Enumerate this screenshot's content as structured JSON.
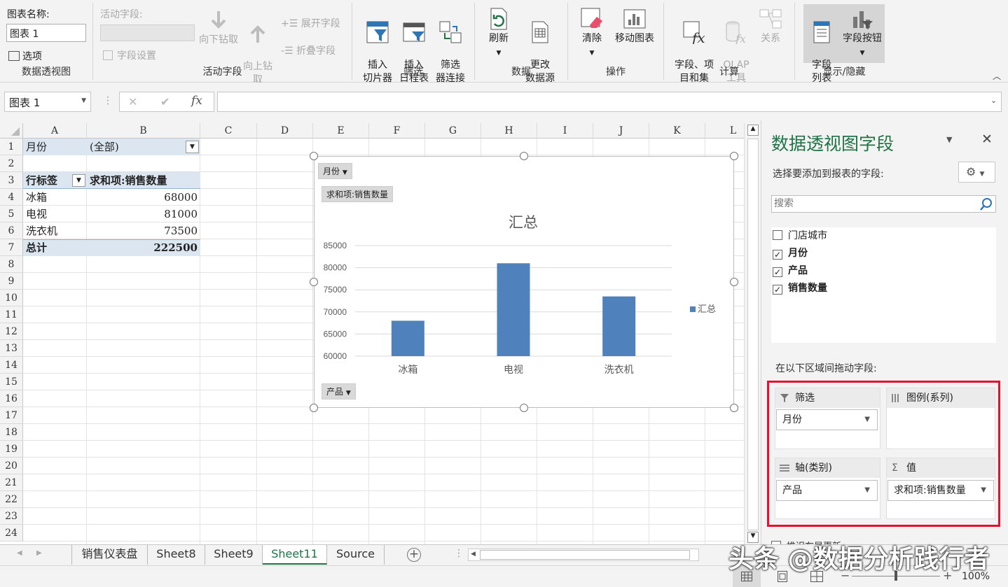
{
  "ribbon": {
    "pivotchart_name_label": "图表名称:",
    "pivotchart_name_value": "图表 1",
    "options_label": "选项",
    "group_pivotchart": "数据透视图",
    "active_field_label": "活动字段:",
    "field_settings": "字段设置",
    "drill_down": "向下钻取",
    "drill_up": "向上钻\n取",
    "expand_field": "展开字段",
    "collapse_field": "折叠字段",
    "group_active_field": "活动字段",
    "insert_slicer": "插入\n切片器",
    "insert_timeline": "插入\n日程表",
    "filter_connections": "筛选\n器连接",
    "group_filter": "筛选",
    "refresh": "刷新",
    "change_source": "更改\n数据源",
    "group_data": "数据",
    "clear": "清除",
    "move_chart": "移动图表",
    "group_actions": "操作",
    "fields_items_sets": "字段、项\n目和集",
    "olap_tools": "OLAP\n工具",
    "relationships": "关系",
    "group_calculations": "计算",
    "field_list": "字段\n列表",
    "field_buttons": "字段按钮",
    "group_show_hide": "显示/隐藏"
  },
  "formula_bar": {
    "name_box": "图表 1",
    "cancel": "✕",
    "enter": "✔",
    "fx": "fx",
    "formula": ""
  },
  "sheet": {
    "columns": [
      "A",
      "B",
      "C",
      "D",
      "E",
      "F",
      "G",
      "H",
      "I",
      "J",
      "K",
      "L"
    ],
    "rows": [
      "1",
      "2",
      "3",
      "4",
      "5",
      "6",
      "7",
      "8",
      "9",
      "10",
      "11",
      "12",
      "13",
      "14",
      "15",
      "16",
      "17",
      "18",
      "19",
      "20",
      "21",
      "22",
      "23",
      "24"
    ],
    "filter_label": "月份",
    "filter_value": "(全部)",
    "row_labels_header": "行标签",
    "sum_header": "求和项:销售数量",
    "data": [
      {
        "label": "冰箱",
        "value": "68000"
      },
      {
        "label": "电视",
        "value": "81000"
      },
      {
        "label": "洗衣机",
        "value": "73500"
      }
    ],
    "total_label": "总计",
    "total_value": "222500"
  },
  "chart_data": {
    "type": "bar",
    "title": "汇总",
    "categories": [
      "冰箱",
      "电视",
      "洗衣机"
    ],
    "series": [
      {
        "name": "汇总",
        "values": [
          68000,
          81000,
          73500
        ]
      }
    ],
    "ylim": [
      60000,
      85000
    ],
    "yticks": [
      "85000",
      "80000",
      "75000",
      "70000",
      "65000",
      "60000"
    ],
    "legend_position": "right",
    "color": "#4f81bd",
    "filter_button": "月份",
    "value_button": "求和项:销售数量",
    "axis_button": "产品"
  },
  "panel": {
    "title": "数据透视图字段",
    "subtitle": "选择要添加到报表的字段:",
    "search_placeholder": "搜索",
    "fields": [
      {
        "name": "门店城市",
        "checked": false
      },
      {
        "name": "月份",
        "checked": true
      },
      {
        "name": "产品",
        "checked": true
      },
      {
        "name": "销售数量",
        "checked": true
      }
    ],
    "drag_label": "在以下区域间拖动字段:",
    "filters_label": "筛选",
    "legend_label": "图例(系列)",
    "axis_label": "轴(类别)",
    "values_label": "值",
    "filter_item": "月份",
    "axis_item": "产品",
    "value_item": "求和项:销售数量",
    "defer_label": "推迟布局更新"
  },
  "tabs": [
    "销售仪表盘",
    "Sheet8",
    "Sheet9",
    "Sheet11",
    "Source"
  ],
  "active_tab": "Sheet11",
  "status": {
    "zoom": "100%"
  },
  "watermark": "头条 @数据分析践行者"
}
